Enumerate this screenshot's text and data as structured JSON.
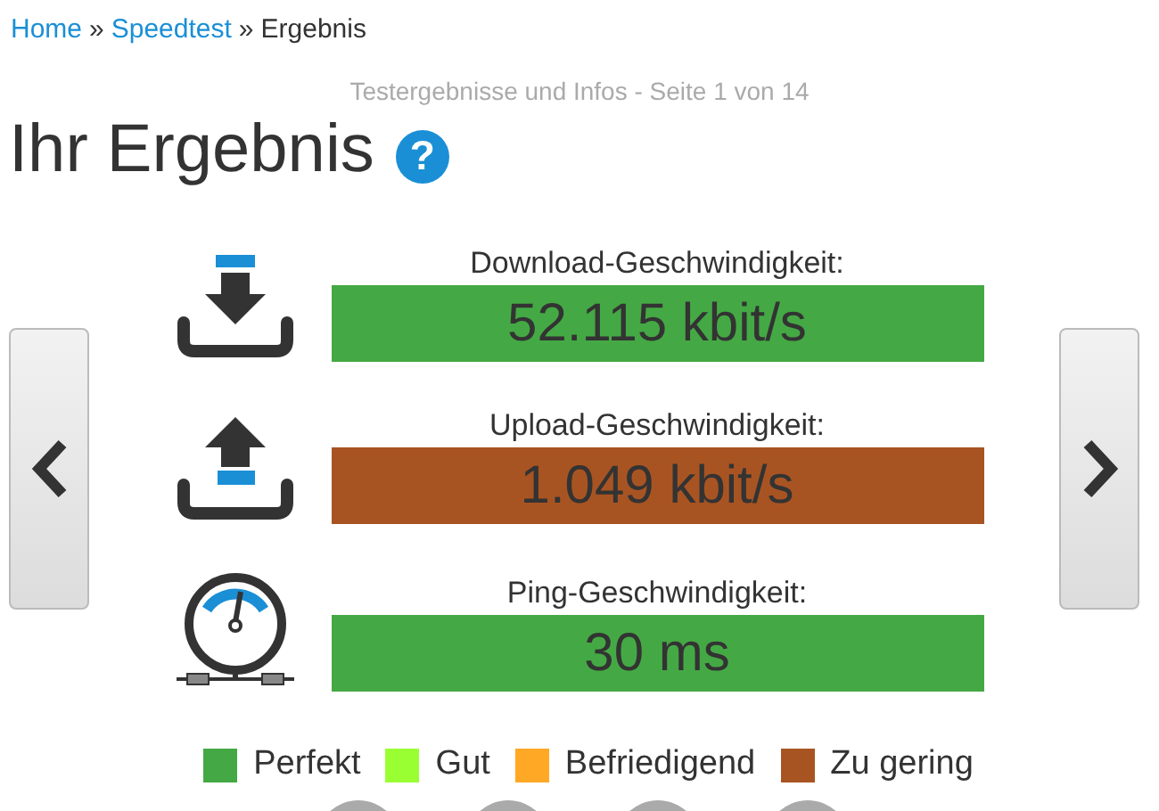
{
  "breadcrumb": [
    {
      "label": "Home",
      "link": true
    },
    {
      "label": "Speedtest",
      "link": true
    },
    {
      "label": "Ergebnis",
      "link": false
    }
  ],
  "breadcrumb_separator": "»",
  "subtitle": "Testergebnisse und Infos - Seite 1 von 14",
  "title": "Ihr Ergebnis",
  "help": "?",
  "results": [
    {
      "kind": "download",
      "label": "Download-Geschwindigkeit:",
      "value": "52.115 kbit/s",
      "color": "#44a944"
    },
    {
      "kind": "upload",
      "label": "Upload-Geschwindigkeit:",
      "value": "1.049 kbit/s",
      "color": "#a85422"
    },
    {
      "kind": "ping",
      "label": "Ping-Geschwindigkeit:",
      "value": "30 ms",
      "color": "#44a944"
    }
  ],
  "legend": [
    {
      "label": "Perfekt",
      "color": "#44a944"
    },
    {
      "label": "Gut",
      "color": "#99ff33"
    },
    {
      "label": "Befriedigend",
      "color": "#ffa826"
    },
    {
      "label": "Zu gering",
      "color": "#a85422"
    }
  ]
}
